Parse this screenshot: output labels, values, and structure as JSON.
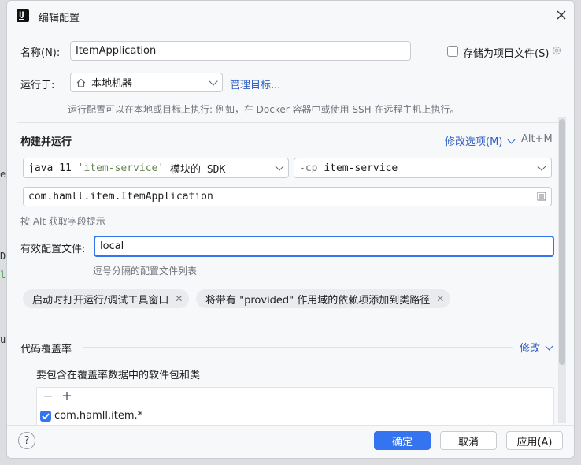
{
  "window": {
    "title": "编辑配置"
  },
  "name_row": {
    "label": "名称(N):",
    "value": "ItemApplication",
    "store_label": "存储为项目文件(S)"
  },
  "run_on": {
    "label": "运行于:",
    "value": "本地机器",
    "manage_link": "管理目标...",
    "hint": "运行配置可以在本地或目标上执行: 例如，在 Docker 容器中或使用 SSH 在远程主机上执行。"
  },
  "build": {
    "title": "构建并运行",
    "modify_options": "修改选项(M)",
    "shortcut": "Alt+M",
    "jdk": {
      "prefix": "java 11",
      "module": "'item-service'",
      "suffix": "模块的 SDK"
    },
    "cp": {
      "flag": "-cp",
      "value": "item-service"
    },
    "main_class": "com.hamll.item.ItemApplication",
    "alt_hint": "按 Alt 获取字段提示"
  },
  "profiles": {
    "label": "有效配置文件:",
    "value": "local",
    "hint": "逗号分隔的配置文件列表"
  },
  "chips": [
    {
      "label": "启动时打开运行/调试工具窗口"
    },
    {
      "label": "将带有 \"provided\" 作用域的依赖项添加到类路径"
    }
  ],
  "coverage": {
    "title": "代码覆盖率",
    "modify": "修改",
    "include_label": "要包含在覆盖率数据中的软件包和类",
    "items": [
      {
        "label": "com.hamll.item.*",
        "checked": true
      }
    ]
  },
  "footer": {
    "help": "?",
    "ok": "确定",
    "cancel": "取消",
    "apply": "应用(A)"
  },
  "colors": {
    "accent": "#3574f0",
    "link": "#2f5fc5"
  }
}
